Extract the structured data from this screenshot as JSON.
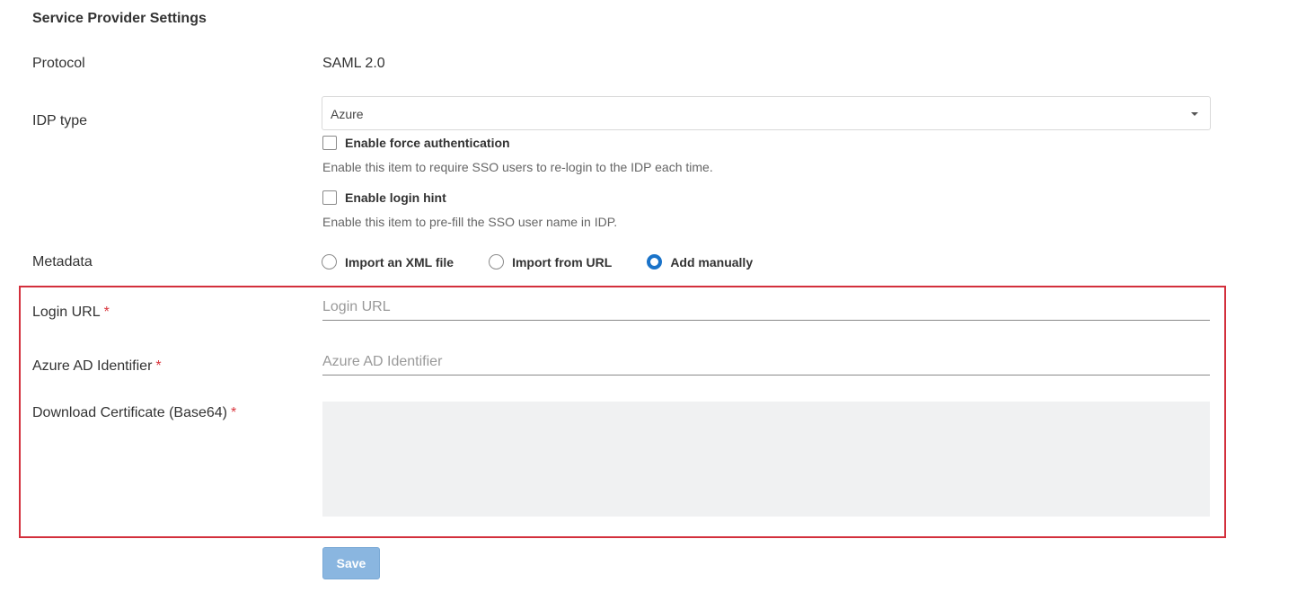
{
  "section": {
    "title": "Service Provider Settings"
  },
  "protocol": {
    "label": "Protocol",
    "value": "SAML 2.0"
  },
  "idp_type": {
    "label": "IDP type",
    "selected": "Azure"
  },
  "force_auth": {
    "label": "Enable force authentication",
    "help": "Enable this item to require SSO users to re-login to the IDP each time.",
    "checked": false
  },
  "login_hint": {
    "label": "Enable login hint",
    "help": "Enable this item to pre-fill the SSO user name in IDP.",
    "checked": false
  },
  "metadata": {
    "label": "Metadata",
    "options": [
      {
        "label": "Import an XML file",
        "checked": false
      },
      {
        "label": "Import from URL",
        "checked": false
      },
      {
        "label": "Add manually",
        "checked": true
      }
    ]
  },
  "login_url": {
    "label": "Login URL",
    "required_mark": "*",
    "placeholder": "Login URL",
    "value": ""
  },
  "azure_ad_identifier": {
    "label": "Azure AD Identifier",
    "required_mark": "*",
    "placeholder": "Azure AD Identifier",
    "value": ""
  },
  "certificate": {
    "label": "Download Certificate (Base64)",
    "required_mark": "*",
    "value": ""
  },
  "actions": {
    "save_label": "Save"
  },
  "colors": {
    "accent": "#1a73c9",
    "highlight_border": "#d32f3c",
    "required": "#d9363e",
    "save_disabled": "#8ab6e0"
  }
}
